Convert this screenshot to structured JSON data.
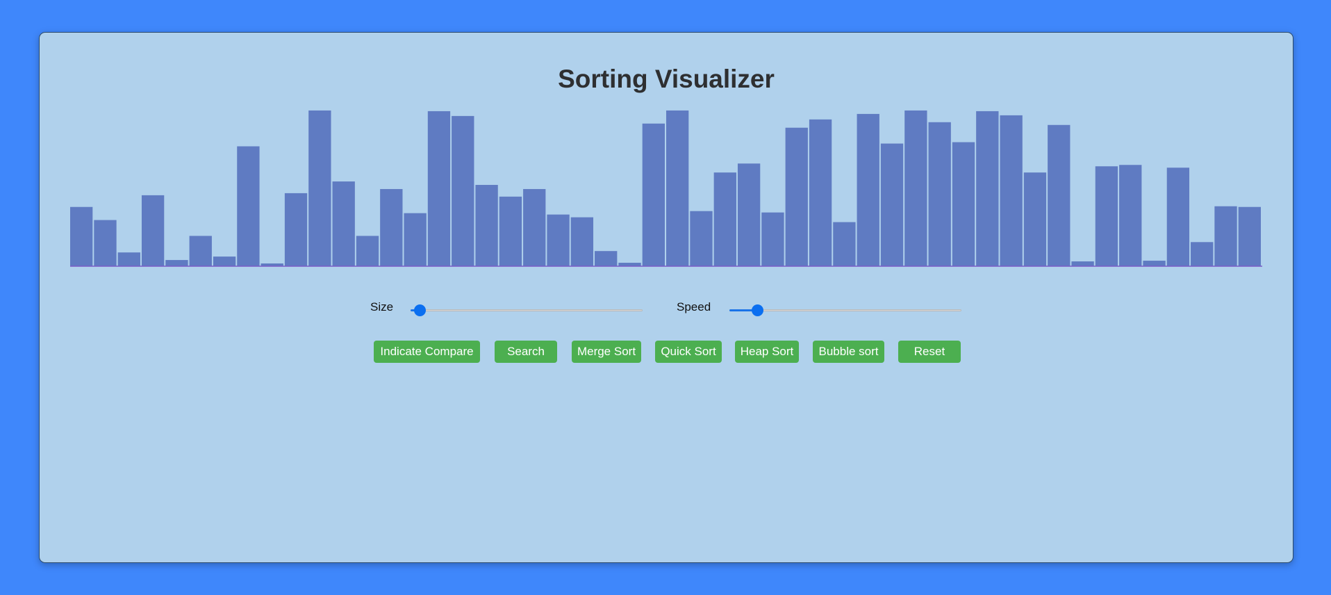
{
  "app": {
    "title": "Sorting Visualizer"
  },
  "controls": {
    "size_label": "Size",
    "speed_label": "Speed",
    "size_value": 0.04,
    "speed_value": 0.12
  },
  "buttons": [
    {
      "label": "Indicate Compare"
    },
    {
      "label": "Search"
    },
    {
      "label": "Merge Sort"
    },
    {
      "label": "Quick Sort"
    },
    {
      "label": "Heap Sort"
    },
    {
      "label": "Bubble sort"
    },
    {
      "label": "Reset"
    }
  ],
  "colors": {
    "background": "#3f87fb",
    "panel": "#b0d1ec",
    "bar": "#5f7bc2",
    "bar_baseline": "#7b5cc6",
    "button": "#4caf50",
    "slider_accent": "#0b6ff0"
  },
  "chart_data": {
    "type": "bar",
    "values": [
      86,
      67,
      20,
      103,
      9,
      44,
      14,
      174,
      4,
      106,
      226,
      123,
      44,
      112,
      77,
      225,
      218,
      118,
      101,
      112,
      75,
      71,
      22,
      5,
      207,
      226,
      80,
      136,
      149,
      78,
      201,
      213,
      64,
      221,
      178,
      226,
      209,
      180,
      225,
      219,
      136,
      205,
      7,
      145,
      147,
      8,
      143,
      35,
      87,
      86
    ],
    "ylim": [
      0,
      232
    ]
  }
}
